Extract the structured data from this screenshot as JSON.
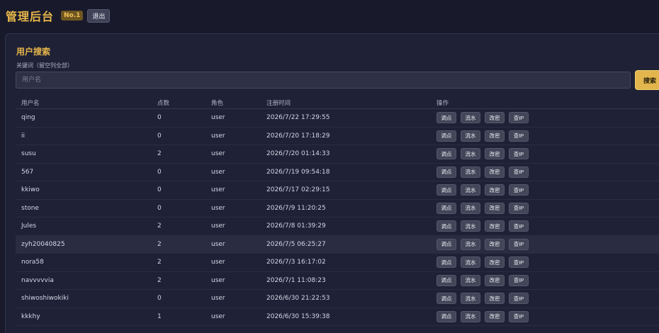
{
  "header": {
    "title": "管理后台",
    "badge": "No.1",
    "logout_label": "退出"
  },
  "search": {
    "section_title": "用户搜索",
    "field_label": "关键词（留空列全部）",
    "placeholder": "用户名",
    "value": "",
    "button_label": "搜索"
  },
  "table": {
    "columns": {
      "username": "用户名",
      "points": "点数",
      "role": "角色",
      "registered": "注册时间",
      "actions": "操作"
    },
    "action_labels": {
      "adjust": "调点",
      "history": "流水",
      "password": "改密",
      "ip": "查IP"
    },
    "rows": [
      {
        "username": "qing",
        "points": "0",
        "role": "user",
        "registered": "2026/7/22 17:29:55"
      },
      {
        "username": "ii",
        "points": "0",
        "role": "user",
        "registered": "2026/7/20 17:18:29"
      },
      {
        "username": "susu",
        "points": "2",
        "role": "user",
        "registered": "2026/7/20 01:14:33"
      },
      {
        "username": "567",
        "points": "0",
        "role": "user",
        "registered": "2026/7/19 09:54:18"
      },
      {
        "username": "kkiwo",
        "points": "0",
        "role": "user",
        "registered": "2026/7/17 02:29:15"
      },
      {
        "username": "stone",
        "points": "0",
        "role": "user",
        "registered": "2026/7/9 11:20:25"
      },
      {
        "username": "Jules",
        "points": "2",
        "role": "user",
        "registered": "2026/7/8 01:39:29"
      },
      {
        "username": "zyh20040825",
        "points": "2",
        "role": "user",
        "registered": "2026/7/5 06:25:27"
      },
      {
        "username": "nora58",
        "points": "2",
        "role": "user",
        "registered": "2026/7/3 16:17:02"
      },
      {
        "username": "navvvvvia",
        "points": "2",
        "role": "user",
        "registered": "2026/7/1 11:08:23"
      },
      {
        "username": "shiwoshiwokiki",
        "points": "0",
        "role": "user",
        "registered": "2026/6/30 21:22:53"
      },
      {
        "username": "kkkhy",
        "points": "1",
        "role": "user",
        "registered": "2026/6/30 15:39:38"
      }
    ]
  },
  "colors": {
    "accent": "#e8b64a",
    "background": "#181a2b",
    "panel": "#1f2236"
  }
}
